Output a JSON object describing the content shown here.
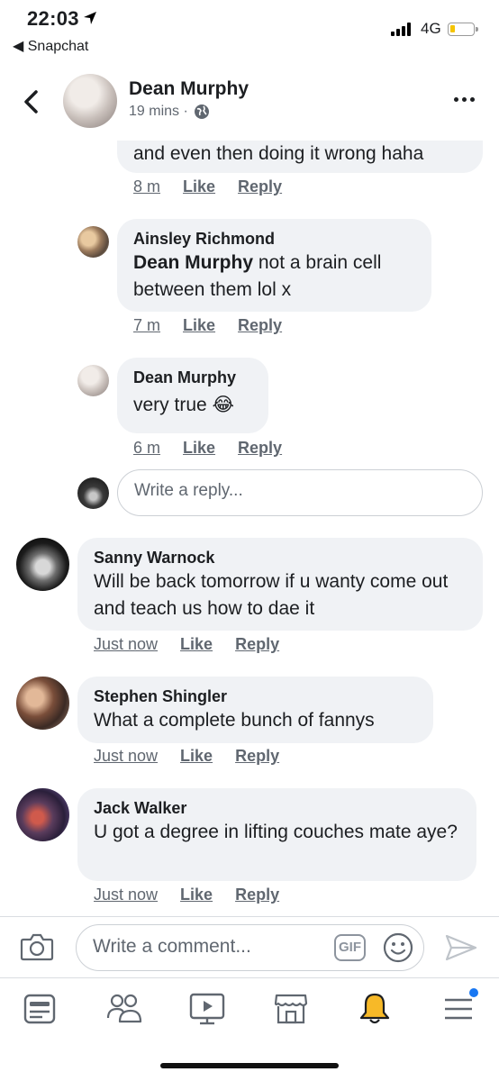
{
  "status_bar": {
    "time": "22:03",
    "back_app": "◀ Snapchat",
    "network": "4G"
  },
  "header": {
    "name": "Dean Murphy",
    "time": "19 mins ·"
  },
  "thread": {
    "first": {
      "text": "and even then doing it wrong haha",
      "time": "8 m",
      "like": "Like",
      "reply": "Reply"
    },
    "replies": [
      {
        "author": "Ainsley Richmond",
        "mention": "Dean Murphy",
        "text": " not a brain cell between them lol x",
        "time": "7 m",
        "like": "Like",
        "reply": "Reply"
      },
      {
        "author": "Dean Murphy",
        "text": "very true 😂",
        "time": "6 m",
        "like": "Like",
        "reply": "Reply"
      }
    ],
    "reply_placeholder": "Write a reply..."
  },
  "comments": [
    {
      "author": "Sanny Warnock",
      "text": "Will be back tomorrow if u wanty come out and teach us how to dae it",
      "time": "Just now",
      "like": "Like",
      "reply": "Reply"
    },
    {
      "author": "Stephen Shingler",
      "text": "What a complete bunch of fannys",
      "time": "Just now",
      "like": "Like",
      "reply": "Reply"
    },
    {
      "author": "Jack Walker",
      "text": "U got a degree in lifting couches mate aye?",
      "time": "Just now",
      "like": "Like",
      "reply": "Reply"
    }
  ],
  "composer": {
    "placeholder": "Write a comment...",
    "gif": "GIF"
  },
  "tabs": [
    "news-feed-icon",
    "groups-icon",
    "watch-icon",
    "marketplace-icon",
    "notifications-icon",
    "menu-icon"
  ],
  "colors": {
    "bubble": "#f0f2f5",
    "meta": "#606770",
    "accent": "#1877f2",
    "bell": "#f7b928"
  }
}
